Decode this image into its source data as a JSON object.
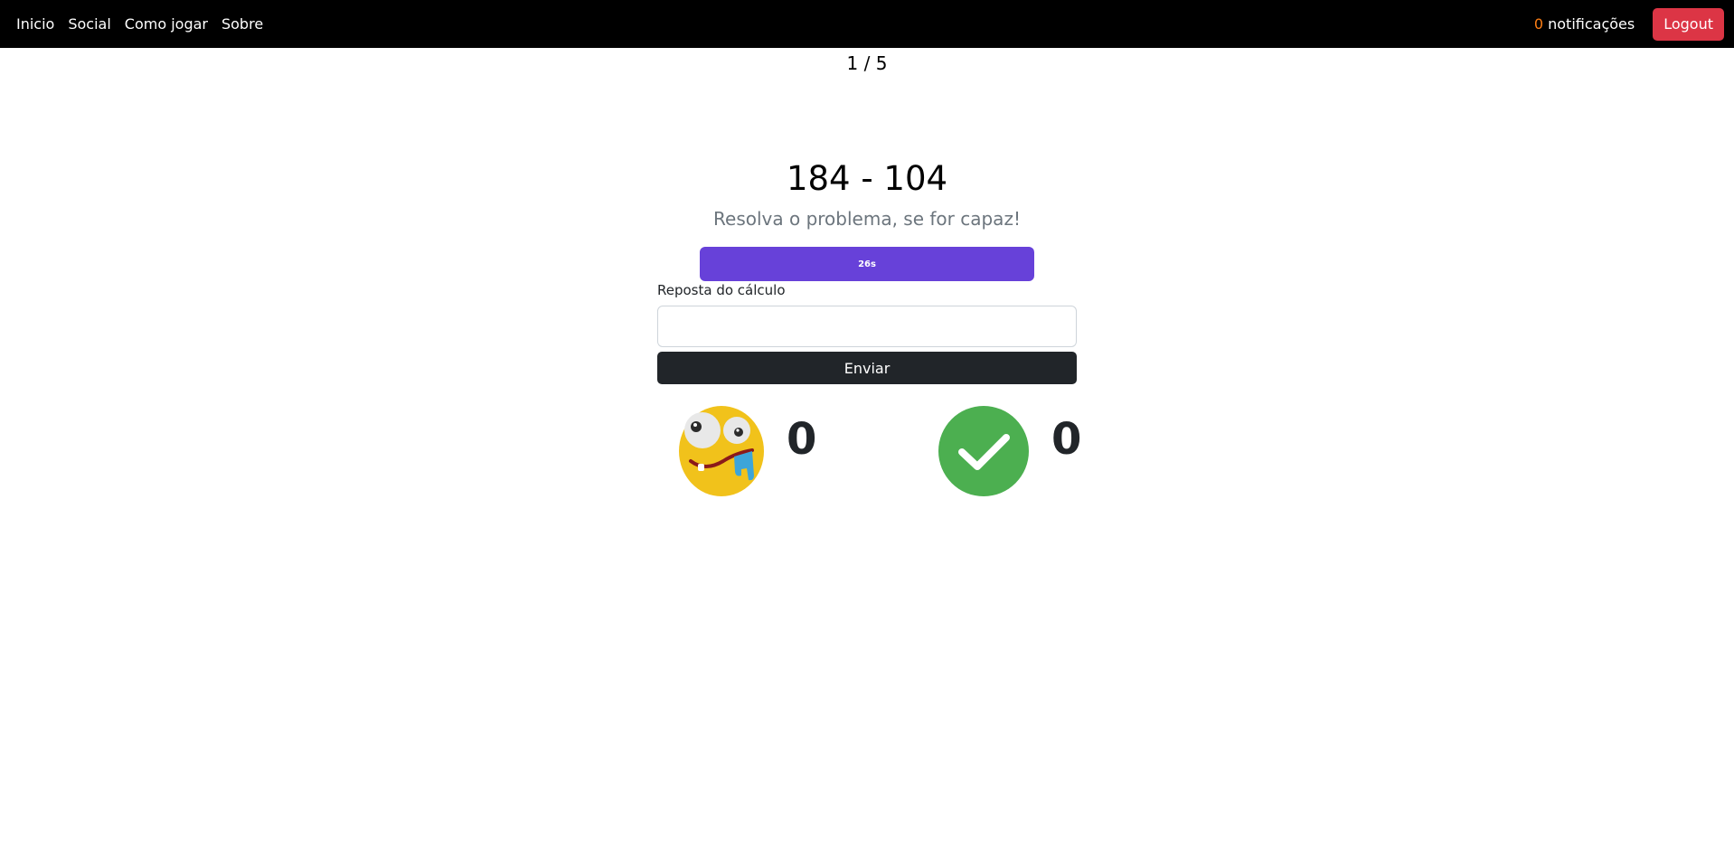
{
  "nav": {
    "links": [
      "Inicio",
      "Social",
      "Como jogar",
      "Sobre"
    ],
    "notifications_count": "0",
    "notifications_label": " notificações",
    "logout_label": "Logout"
  },
  "game": {
    "progress": "1 / 5",
    "problem": "184 - 104",
    "subtitle": "Resolva o problema, se for capaz!",
    "timer_label": "26s",
    "timer_fraction": 1.0,
    "answer_label": "Reposta do cálculo",
    "answer_value": "",
    "submit_label": "Enviar"
  },
  "scores": {
    "wrong_icon": "dizzy-face-icon",
    "wrong_count": "0",
    "right_icon": "checkmark-icon",
    "right_count": "0"
  },
  "colors": {
    "navbar": "#000000",
    "logout": "#dc3545",
    "notification_count": "#fd7e14",
    "timer": "#6741d9",
    "submit": "#212529",
    "check_badge": "#4caf50",
    "emoji": "#f1c21b"
  }
}
